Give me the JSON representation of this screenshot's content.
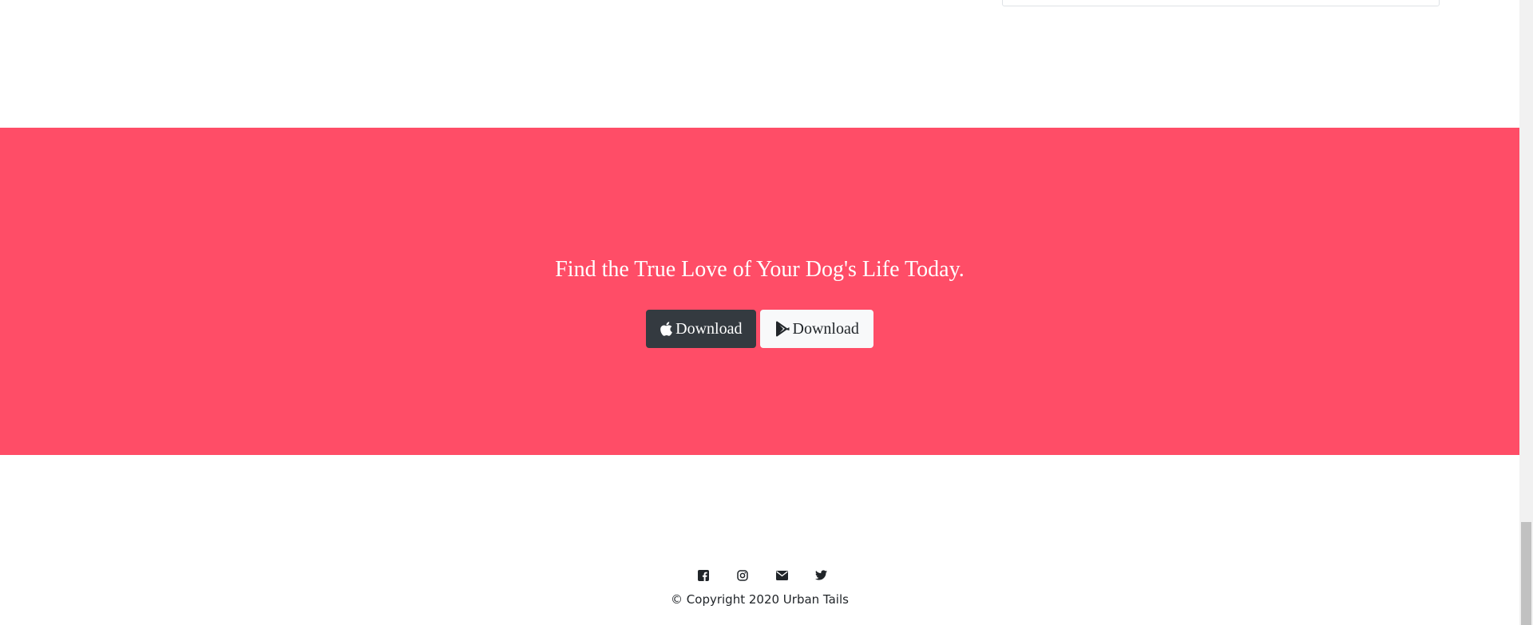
{
  "cta": {
    "heading": "Find the True Love of Your Dog's Life Today.",
    "background_color": "#ff4d67",
    "buttons": [
      {
        "label": "Download",
        "icon": "apple-icon",
        "style": "dark"
      },
      {
        "label": "Download",
        "icon": "google-play-icon",
        "style": "light"
      }
    ]
  },
  "footer": {
    "social_icons": [
      "facebook-icon",
      "instagram-icon",
      "envelope-icon",
      "twitter-icon"
    ],
    "copyright": "© Copyright 2020 Urban Tails"
  }
}
